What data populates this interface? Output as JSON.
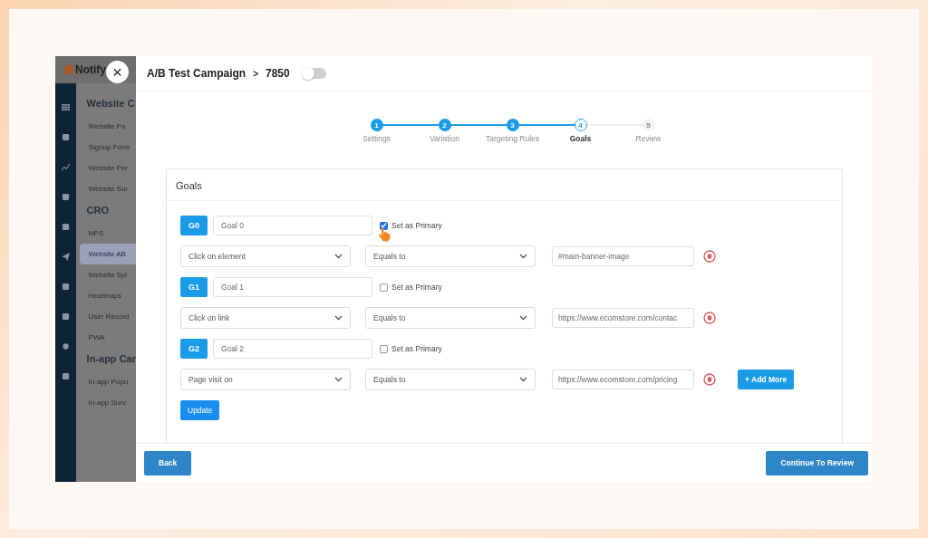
{
  "app": {
    "logo": "Notify",
    "close": "×"
  },
  "sidebar": {
    "items": [
      {
        "kind": "heading",
        "label": "Website C"
      },
      {
        "kind": "item",
        "label": "Website Po",
        "selected": false
      },
      {
        "kind": "item",
        "label": "Signup Form",
        "selected": false
      },
      {
        "kind": "item",
        "label": "Website Per",
        "selected": false
      },
      {
        "kind": "item",
        "label": "Website Sur",
        "selected": false
      },
      {
        "kind": "heading",
        "label": "CRO"
      },
      {
        "kind": "item",
        "label": "NPS",
        "selected": false
      },
      {
        "kind": "item",
        "label": "Website AB",
        "selected": true
      },
      {
        "kind": "item",
        "label": "Website Spl",
        "selected": false
      },
      {
        "kind": "item",
        "label": "Heatmaps",
        "selected": false
      },
      {
        "kind": "item",
        "label": "User Record",
        "selected": false
      },
      {
        "kind": "item",
        "label": "PWA",
        "selected": false
      },
      {
        "kind": "heading",
        "label": "In-app Car"
      },
      {
        "kind": "item",
        "label": "In-app Popu",
        "selected": false
      },
      {
        "kind": "item",
        "label": "In-app Surv",
        "selected": false
      }
    ]
  },
  "header": {
    "campaign": "A/B Test Campaign",
    "separator": ">",
    "id": "7850",
    "toggle_on": false
  },
  "steps": [
    {
      "number": "1",
      "label": "Settings",
      "completed": true,
      "selected": false
    },
    {
      "number": "2",
      "label": "Variation",
      "completed": true,
      "selected": false
    },
    {
      "number": "3",
      "label": "Targeting Rules",
      "completed": true,
      "selected": false
    },
    {
      "number": "4",
      "label": "Goals",
      "completed": false,
      "selected": true
    },
    {
      "number": "5",
      "label": "Review",
      "completed": false,
      "selected": false
    }
  ],
  "goals_card": {
    "title": "Goals",
    "goals": [
      {
        "badge": "G0",
        "name": "Goal 0",
        "primary_label": "Set as Primary",
        "checked": true,
        "trigger": "Click on element",
        "operator": "Equals to",
        "value": "#main-banner-image"
      },
      {
        "badge": "G1",
        "name": "Goal 1",
        "primary_label": "Set as Primary",
        "checked": false,
        "trigger": "Click on link",
        "operator": "Equals to",
        "value": "https://www.ecomstore.com/contac"
      },
      {
        "badge": "G2",
        "name": "Goal 2",
        "primary_label": "Set as Primary",
        "checked": false,
        "trigger": "Page visit on",
        "operator": "Equals to",
        "value": "https://www.ecomstore.com/pricing"
      }
    ],
    "add_more": "+ Add More",
    "update": "Update"
  },
  "footer": {
    "back": "Back",
    "continue": "Continue To Review"
  }
}
